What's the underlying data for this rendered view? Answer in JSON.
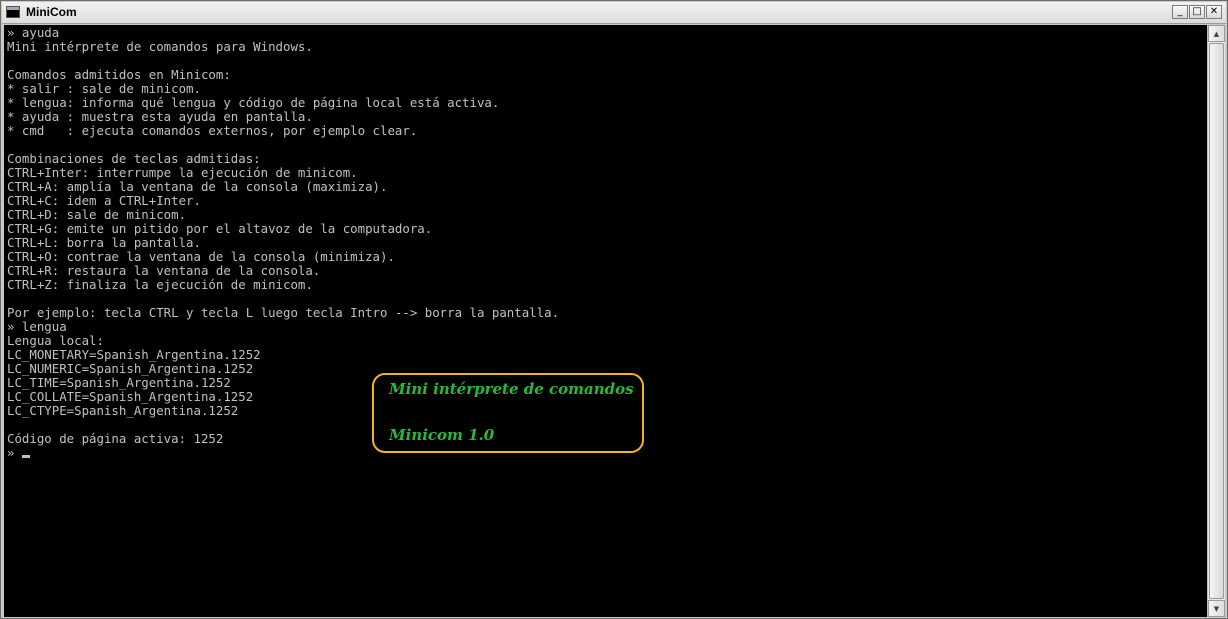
{
  "window": {
    "title": "MiniCom",
    "minimize_glyph": "_",
    "maximize_glyph": "□",
    "close_glyph": "✕",
    "app_icon": "console-window-icon"
  },
  "console": {
    "lines": [
      "» ayuda",
      "Mini intérprete de comandos para Windows.",
      "",
      "Comandos admitidos en Minicom:",
      "* salir : sale de minicom.",
      "* lengua: informa qué lengua y código de página local está activa.",
      "* ayuda : muestra esta ayuda en pantalla.",
      "* cmd   : ejecuta comandos externos, por ejemplo clear.",
      "",
      "Combinaciones de teclas admitidas:",
      "CTRL+Inter: interrumpe la ejecución de minicom.",
      "CTRL+A: amplía la ventana de la consola (maximiza).",
      "CTRL+C: idem a CTRL+Inter.",
      "CTRL+D: sale de minicom.",
      "CTRL+G: emite un pitido por el altavoz de la computadora.",
      "CTRL+L: borra la pantalla.",
      "CTRL+O: contrae la ventana de la consola (minimiza).",
      "CTRL+R: restaura la ventana de la consola.",
      "CTRL+Z: finaliza la ejecución de minicom.",
      "",
      "Por ejemplo: tecla CTRL y tecla L luego tecla Intro --> borra la pantalla.",
      "» lengua",
      "Lengua local:",
      "LC_MONETARY=Spanish_Argentina.1252",
      "LC_NUMERIC=Spanish_Argentina.1252",
      "LC_TIME=Spanish_Argentina.1252",
      "LC_COLLATE=Spanish_Argentina.1252",
      "LC_CTYPE=Spanish_Argentina.1252",
      "",
      "Código de página activa: 1252"
    ],
    "prompt": "» ",
    "text_color": "#c0c0c0",
    "background_color": "#000000"
  },
  "overlay": {
    "line1": "Mini intérprete de comandos",
    "line2": "Minicom 1.0",
    "text_color": "#2bb83a",
    "border_color": "#f4b41b"
  },
  "scrollbar": {
    "up_icon": "scroll-up-arrow-icon",
    "down_icon": "scroll-down-arrow-icon"
  }
}
